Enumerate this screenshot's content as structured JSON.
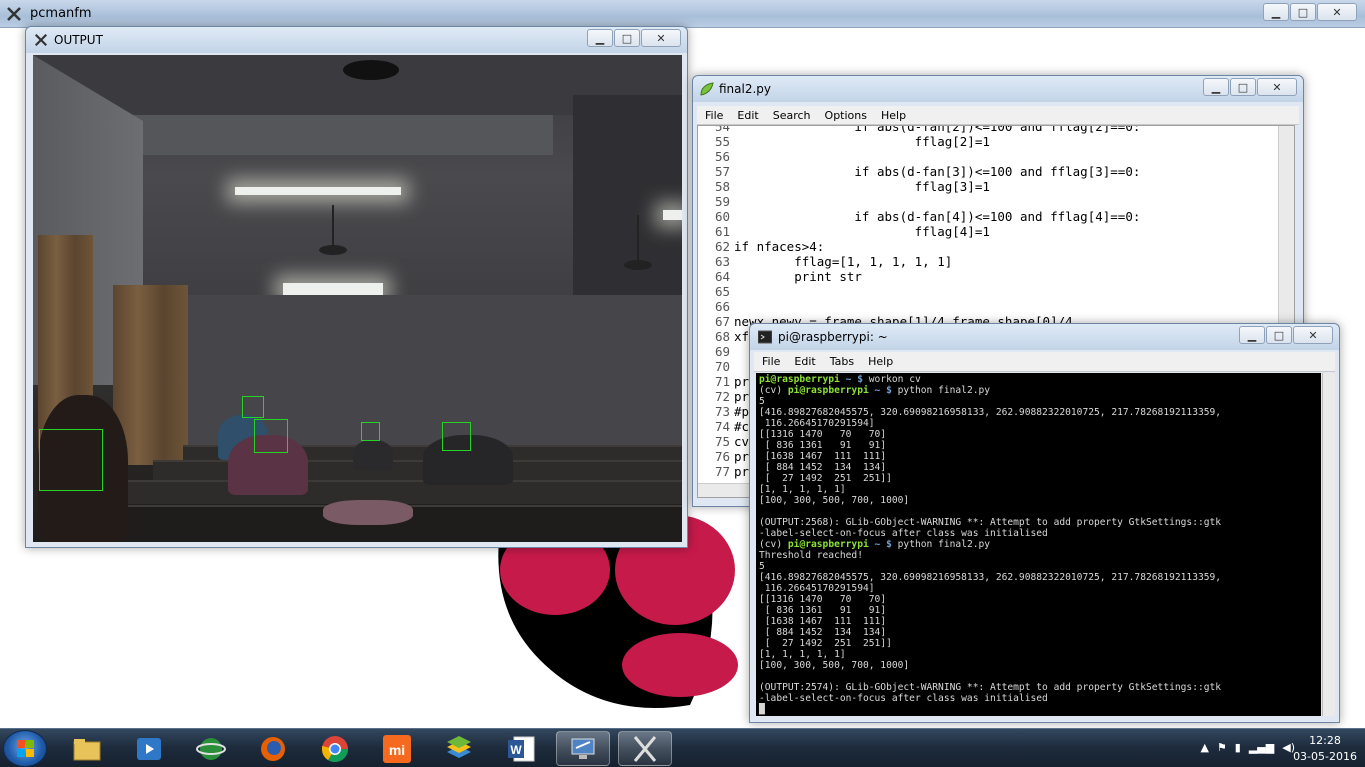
{
  "outer_window": {
    "title": "pcmanfm"
  },
  "output_window": {
    "title": "OUTPUT"
  },
  "editor_window": {
    "title": "final2.py",
    "menu": [
      "File",
      "Edit",
      "Search",
      "Options",
      "Help"
    ],
    "lines": [
      {
        "num": "54",
        "text": "                if abs(d-fan[2])<=100 and fflag[2]==0:"
      },
      {
        "num": "55",
        "text": "                        fflag[2]=1"
      },
      {
        "num": "56",
        "text": ""
      },
      {
        "num": "57",
        "text": "                if abs(d-fan[3])<=100 and fflag[3]==0:"
      },
      {
        "num": "58",
        "text": "                        fflag[3]=1"
      },
      {
        "num": "59",
        "text": ""
      },
      {
        "num": "60",
        "text": "                if abs(d-fan[4])<=100 and fflag[4]==0:"
      },
      {
        "num": "61",
        "text": "                        fflag[4]=1"
      },
      {
        "num": "62",
        "text": "if nfaces>4:"
      },
      {
        "num": "63",
        "text": "        fflag=[1, 1, 1, 1, 1]"
      },
      {
        "num": "64",
        "text": "        print str"
      },
      {
        "num": "65",
        "text": ""
      },
      {
        "num": "66",
        "text": ""
      },
      {
        "num": "67",
        "text": "newx,newy = frame.shape[1]/4,frame.shape[0]/4"
      },
      {
        "num": "68",
        "text": "xf"
      },
      {
        "num": "69",
        "text": ""
      },
      {
        "num": "70",
        "text": ""
      },
      {
        "num": "71",
        "text": "pr"
      },
      {
        "num": "72",
        "text": "pr"
      },
      {
        "num": "73",
        "text": "#p"
      },
      {
        "num": "74",
        "text": "#c"
      },
      {
        "num": "75",
        "text": "cv"
      },
      {
        "num": "76",
        "text": "pr"
      },
      {
        "num": "77",
        "text": "pr"
      }
    ]
  },
  "terminal_window": {
    "title": "pi@raspberrypi: ~",
    "menu": [
      "File",
      "Edit",
      "Tabs",
      "Help"
    ],
    "prompt_user": "pi@raspberrypi",
    "lines": [
      {
        "pre": "",
        "user": "pi@raspberrypi",
        "path": " ~ $",
        "cmd": " workon cv"
      },
      {
        "pre": "(cv) ",
        "user": "pi@raspberrypi",
        "path": " ~ $",
        "cmd": " python final2.py"
      },
      {
        "text": "5"
      },
      {
        "text": "[416.89827682045575, 320.69098216958133, 262.90882322010725, 217.78268192113359,"
      },
      {
        "text": " 116.26645170291594]"
      },
      {
        "text": "[[1316 1470   70   70]"
      },
      {
        "text": " [ 836 1361   91   91]"
      },
      {
        "text": " [1638 1467  111  111]"
      },
      {
        "text": " [ 884 1452  134  134]"
      },
      {
        "text": " [  27 1492  251  251]]"
      },
      {
        "text": "[1, 1, 1, 1, 1]"
      },
      {
        "text": "[100, 300, 500, 700, 1000]"
      },
      {
        "text": ""
      },
      {
        "text": "(OUTPUT:2568): GLib-GObject-WARNING **: Attempt to add property GtkSettings::gtk"
      },
      {
        "text": "-label-select-on-focus after class was initialised"
      },
      {
        "pre": "(cv) ",
        "user": "pi@raspberrypi",
        "path": " ~ $",
        "cmd": " python final2.py"
      },
      {
        "text": "Threshold reached!"
      },
      {
        "text": "5"
      },
      {
        "text": "[416.89827682045575, 320.69098216958133, 262.90882322010725, 217.78268192113359,"
      },
      {
        "text": " 116.26645170291594]"
      },
      {
        "text": "[[1316 1470   70   70]"
      },
      {
        "text": " [ 836 1361   91   91]"
      },
      {
        "text": " [1638 1467  111  111]"
      },
      {
        "text": " [ 884 1452  134  134]"
      },
      {
        "text": " [  27 1492  251  251]]"
      },
      {
        "text": "[1, 1, 1, 1, 1]"
      },
      {
        "text": "[100, 300, 500, 700, 1000]"
      },
      {
        "text": ""
      },
      {
        "text": "(OUTPUT:2574): GLib-GObject-WARNING **: Attempt to add property GtkSettings::gtk"
      },
      {
        "text": "-label-select-on-focus after class was initialised"
      },
      {
        "text": "█"
      }
    ]
  },
  "taskbar": {
    "apps": [
      "windows-explorer",
      "media-player",
      "network-app",
      "firefox",
      "chrome",
      "mi-app",
      "bluestacks",
      "word",
      "remote-desktop",
      "xming"
    ],
    "clock_time": "12:28",
    "clock_date": "03-05-2016"
  },
  "colors": {
    "face_box": "#26d226",
    "prompt_green": "#8ae234",
    "prompt_blue": "#729fcf",
    "raspberry_red": "#c51a4a"
  }
}
